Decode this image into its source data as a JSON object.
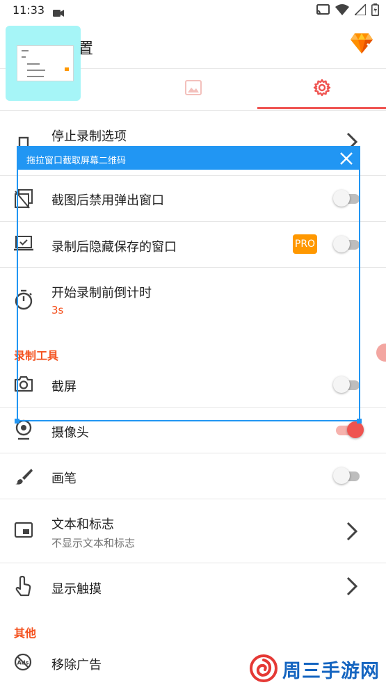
{
  "status": {
    "time": "11:33"
  },
  "app_bar": {
    "title_visible": "置"
  },
  "tabs": [
    {
      "name": "video",
      "selected": false
    },
    {
      "name": "image",
      "selected": false
    },
    {
      "name": "settings",
      "selected": true
    }
  ],
  "settings": {
    "stop_recording": {
      "title": "停止录制选项"
    },
    "disable_popup": {
      "title": "截图后禁用弹出窗口",
      "enabled": false
    },
    "hide_window": {
      "title": "录制后隐藏保存的窗口",
      "badge": "PRO",
      "enabled": false
    },
    "countdown": {
      "title": "开始录制前倒计时",
      "value": "3s"
    },
    "section_tools": "录制工具",
    "screenshot": {
      "title": "截屏",
      "enabled": false
    },
    "camera": {
      "title": "摄像头",
      "enabled": true
    },
    "brush": {
      "title": "画笔",
      "enabled": false
    },
    "text_logo": {
      "title": "文本和标志",
      "subtitle": "不显示文本和标志"
    },
    "show_touch": {
      "title": "显示触摸"
    },
    "section_other": "其他",
    "remove_ads": {
      "title": "移除广告"
    }
  },
  "overlay": {
    "title": "拖拉窗口截取屏幕二维码"
  },
  "watermark": {
    "text": "周三手游网"
  },
  "colors": {
    "accent": "#f4511e",
    "primary": "#ef5350",
    "overlay": "#2196f3",
    "pro": "#ff9800"
  }
}
